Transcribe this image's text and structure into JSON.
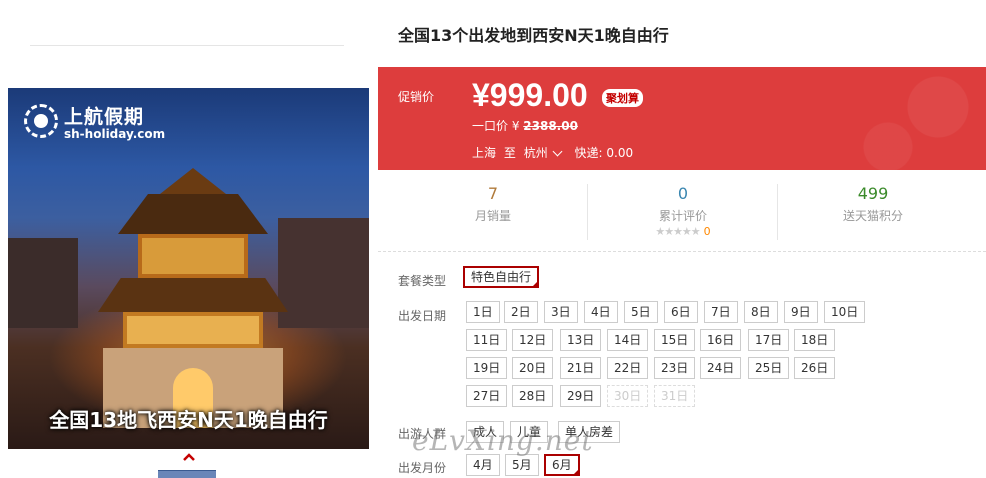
{
  "gallery": {
    "logo_brand": "上航假期",
    "logo_site": "sh-holiday.com",
    "caption": "全国13地飞西安N天1晚自由行"
  },
  "product": {
    "title": "全国13个出发地到西安N天1晚自由行"
  },
  "price_box": {
    "promo_label": "促销价",
    "price": "¥999.00",
    "badge": "聚划算",
    "orig_label": "一口价 ¥",
    "orig_price": "2388.00",
    "from": "上海",
    "to_word": "至",
    "to": "杭州",
    "shipping": "快递: 0.00"
  },
  "stats": {
    "monthly_sales": {
      "value": "7",
      "label": "月销量",
      "color": "#b07a3a"
    },
    "reviews": {
      "value": "0",
      "label": "累计评价",
      "color": "#3a86b0",
      "stars": "★★★★★",
      "stars_count": "0"
    },
    "points": {
      "value": "499",
      "label": "送天猫积分",
      "color": "#3a8a2a"
    }
  },
  "options": {
    "package_label": "套餐类型",
    "package": [
      "特色自由行"
    ],
    "date_label": "出发日期",
    "dates": [
      "1日",
      "2日",
      "3日",
      "4日",
      "5日",
      "6日",
      "7日",
      "8日",
      "9日",
      "10日",
      "11日",
      "12日",
      "13日",
      "14日",
      "15日",
      "16日",
      "17日",
      "18日",
      "19日",
      "20日",
      "21日",
      "22日",
      "23日",
      "24日",
      "25日",
      "26日",
      "27日",
      "28日",
      "29日",
      "30日",
      "31日"
    ],
    "disabled_dates": [
      "30日",
      "31日"
    ],
    "people_label": "出游人群",
    "people": [
      "成人",
      "儿童",
      "单人房差"
    ],
    "month_label": "出发月份",
    "months": [
      "4月",
      "5月",
      "6月"
    ],
    "selected_month": "6月"
  },
  "watermark": "eLvXing.net",
  "colors": {
    "price_bg": "#dd3d3d",
    "selected_border": "#aa0000"
  }
}
